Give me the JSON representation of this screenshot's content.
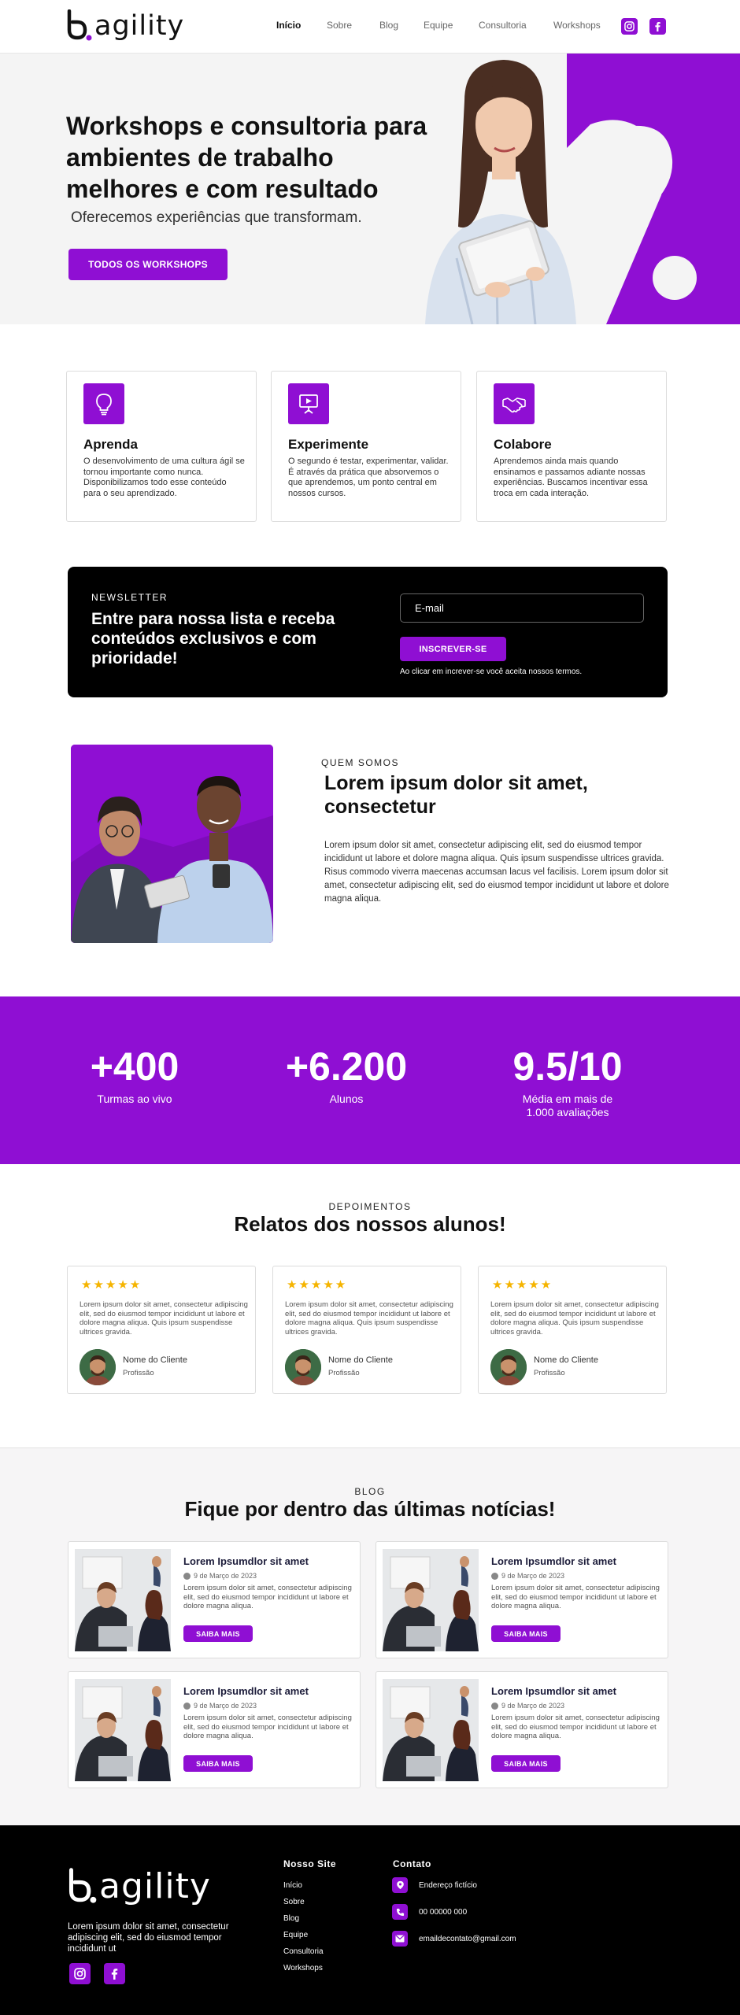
{
  "brand": {
    "name": "agility",
    "accent": "#8f0fd3"
  },
  "nav": {
    "items": [
      "Início",
      "Sobre",
      "Blog",
      "Equipe",
      "Consultoria",
      "Workshops"
    ],
    "social": [
      "instagram-icon",
      "facebook-icon"
    ]
  },
  "hero": {
    "title": "Workshops e consultoria para ambientes de trabalho melhores e com resultado",
    "subtitle": "Oferecemos experiências que transformam.",
    "cta": "TODOS OS WORKSHOPS"
  },
  "features": [
    {
      "icon": "lightbulb-icon",
      "title": "Aprenda",
      "text": "O desenvolvimento de uma cultura ágil se tornou importante como nunca. Disponibilizamos todo esse conteúdo para o seu aprendizado."
    },
    {
      "icon": "presentation-icon",
      "title": "Experimente",
      "text": "O segundo é testar, experimentar, validar. É através da prática que absorvemos o que aprendemos, um ponto central em nossos cursos."
    },
    {
      "icon": "handshake-icon",
      "title": "Colabore",
      "text": "Aprendemos ainda mais quando ensinamos e passamos adiante nossas experiências. Buscamos incentivar essa troca em cada interação."
    }
  ],
  "newsletter": {
    "kicker": "NEWSLETTER",
    "title": "Entre para nossa lista e receba conteúdos exclusivos e com prioridade!",
    "email_placeholder": "E-mail",
    "button": "INSCREVER-SE",
    "terms": "Ao clicar em increver-se você aceita nossos termos."
  },
  "about": {
    "kicker": "QUEM SOMOS",
    "title": "Lorem ipsum dolor sit amet, consectetur",
    "body": "Lorem ipsum dolor sit amet, consectetur adipiscing elit, sed do eiusmod tempor incididunt ut labore et dolore magna aliqua. Quis ipsum suspendisse ultrices gravida. Risus commodo viverra maecenas accumsan lacus vel facilisis. Lorem ipsum dolor sit amet, consectetur adipiscing elit, sed do eiusmod tempor incididunt ut labore et dolore magna aliqua."
  },
  "stats": [
    {
      "value": "+400",
      "label": "Turmas ao vivo"
    },
    {
      "value": "+6.200",
      "label": "Alunos"
    },
    {
      "value": "9.5/10",
      "label": "Média em mais de 1.000 avaliações"
    }
  ],
  "testimonials": {
    "kicker": "DEPOIMENTOS",
    "title": "Relatos dos nossos alunos!",
    "items": [
      {
        "stars": "★★★★★",
        "rating": 5,
        "text": "Lorem ipsum dolor sit amet, consectetur adipiscing elit, sed do eiusmod tempor incididunt ut labore et dolore magna aliqua. Quis ipsum suspendisse ultrices gravida.",
        "name": "Nome do Cliente",
        "role": "Profissão"
      },
      {
        "stars": "★★★★★",
        "rating": 5,
        "text": "Lorem ipsum dolor sit amet, consectetur adipiscing elit, sed do eiusmod tempor incididunt ut labore et dolore magna aliqua. Quis ipsum suspendisse ultrices gravida.",
        "name": "Nome do Cliente",
        "role": "Profissão"
      },
      {
        "stars": "★★★★★",
        "rating": 5,
        "text": "Lorem ipsum dolor sit amet, consectetur adipiscing elit, sed do eiusmod tempor incididunt ut labore et dolore magna aliqua. Quis ipsum suspendisse ultrices gravida.",
        "name": "Nome do Cliente",
        "role": "Profissão"
      }
    ]
  },
  "blog": {
    "kicker": "BLOG",
    "title": "Fique por dentro das últimas notícias!",
    "posts": [
      {
        "title": "Lorem Ipsumdlor sit amet",
        "date": "9 de Março de 2023",
        "text": "Lorem ipsum dolor sit amet, consectetur adipiscing elit, sed do eiusmod tempor incididunt ut labore et dolore magna aliqua.",
        "button": "SAIBA MAIS"
      },
      {
        "title": "Lorem Ipsumdlor sit amet",
        "date": "9 de Março de 2023",
        "text": "Lorem ipsum dolor sit amet, consectetur adipiscing elit, sed do eiusmod tempor incididunt ut labore et dolore magna aliqua.",
        "button": "SAIBA MAIS"
      },
      {
        "title": "Lorem Ipsumdlor sit amet",
        "date": "9 de Março de 2023",
        "text": "Lorem ipsum dolor sit amet, consectetur adipiscing elit, sed do eiusmod tempor incididunt ut labore et dolore magna aliqua.",
        "button": "SAIBA MAIS"
      },
      {
        "title": "Lorem Ipsumdlor sit amet",
        "date": "9 de Março de 2023",
        "text": "Lorem ipsum dolor sit amet, consectetur adipiscing elit, sed do eiusmod tempor incididunt ut labore et dolore magna aliqua.",
        "button": "SAIBA MAIS"
      }
    ]
  },
  "footer": {
    "description": "Lorem ipsum dolor sit amet, consectetur adipiscing elit, sed do eiusmod tempor incididunt ut",
    "site_heading": "Nosso Site",
    "site_links": [
      "Início",
      "Sobre",
      "Blog",
      "Equipe",
      "Consultoria",
      "Workshops"
    ],
    "contact_heading": "Contato",
    "contacts": [
      {
        "icon": "map-pin-icon",
        "text": "Endereço fictício"
      },
      {
        "icon": "phone-icon",
        "text": "00 00000 000"
      },
      {
        "icon": "mail-icon",
        "text": "emaildecontato@gmail.com"
      }
    ]
  }
}
